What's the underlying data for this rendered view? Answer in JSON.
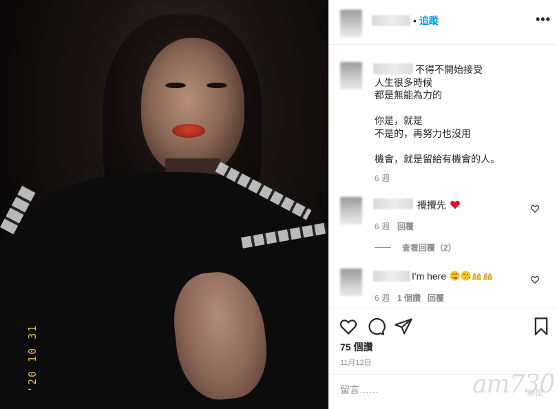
{
  "post": {
    "follow_label": "追蹤",
    "follow_separator": "•",
    "more_label": "•••"
  },
  "caption": {
    "text": "不得不開始接受\n人生很多時候\n都是無能為力的\n\n你是，就是\n不是的，再努力也沒用\n\n機會，就是留給有機會的人。",
    "age": "6 週"
  },
  "comments": [
    {
      "text": "攪攪先",
      "age": "6 週",
      "reply_label": "回覆",
      "emoji": [
        "red-heart"
      ]
    },
    {
      "text": "I'm here",
      "age": "6 週",
      "likes": "1 個讚",
      "reply_label": "回覆",
      "emoji": [
        "face-savoring-food",
        "face-blowing-kiss",
        "raising-hands",
        "raising-hands"
      ]
    }
  ],
  "view_replies_label": "查看回覆（2）",
  "likes_label": "75 個讚",
  "date_label": "11月12日",
  "comment_input": {
    "placeholder": "留言……"
  },
  "photo": {
    "timestamp_stamp": "'20 10 31"
  },
  "watermark": {
    "logo": "am730",
    "sub": "新聞"
  },
  "colors": {
    "link": "#0095f6",
    "meta": "#8e8e8e",
    "text": "#262626",
    "heart": "#e0112e"
  }
}
